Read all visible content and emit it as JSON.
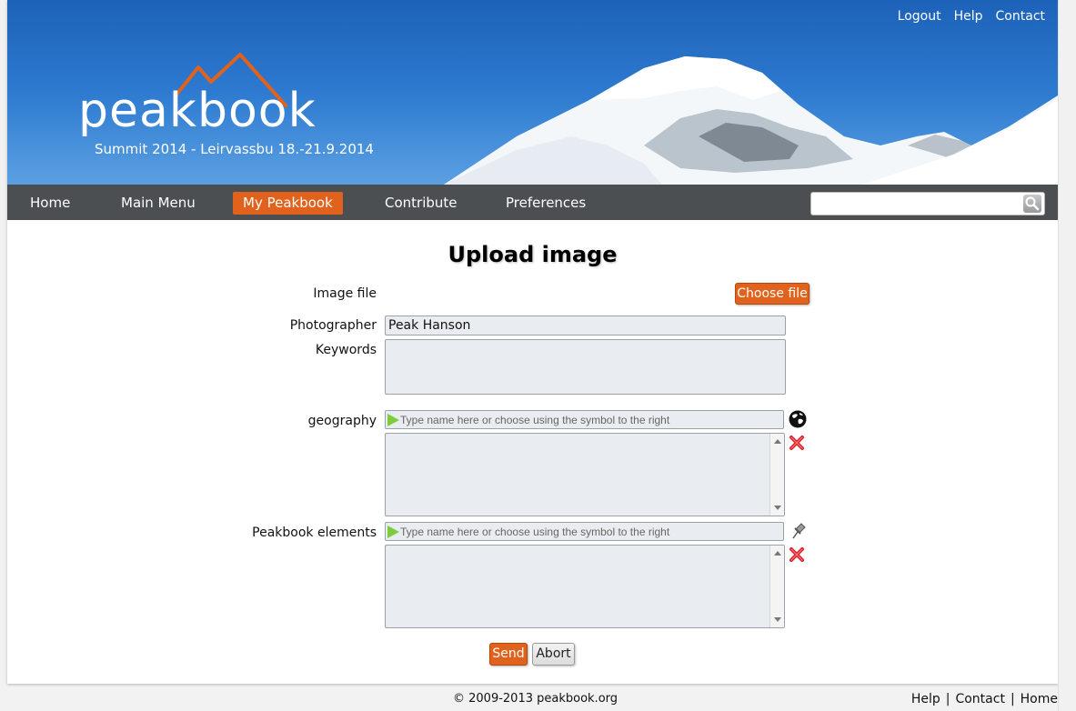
{
  "header": {
    "logo_text": "peakbook",
    "subtitle": "Summit 2014 - Leirvassbu 18.-21.9.2014",
    "top_links": [
      "Logout",
      "Help",
      "Contact"
    ]
  },
  "nav": {
    "items": [
      "Home",
      "Main Menu",
      "My Peakbook",
      "Contribute",
      "Preferences"
    ],
    "active": "My Peakbook",
    "search_value": ""
  },
  "form": {
    "title": "Upload image",
    "image_file_label": "Image file",
    "choose_file_button": "Choose file",
    "photographer_label": "Photographer",
    "photographer_value": "Peak Hanson",
    "keywords_label": "Keywords",
    "keywords_value": "",
    "geography_label": "geography",
    "geography_placeholder": "Type name here or choose using the symbol to the right",
    "elements_label": "Peakbook elements",
    "elements_placeholder": "Type name here or choose using the symbol to the right",
    "send_button": "Send",
    "abort_button": "Abort"
  },
  "icons": {
    "geography_picker": "globe-icon",
    "elements_picker": "pushpin-icon",
    "remove": "red-x-icon",
    "search": "magnifier-icon",
    "combo_marker": "green-play-icon"
  },
  "colors": {
    "accent": "#e0621c",
    "navbar": "#4b4f52",
    "field_bg": "#e9edf1",
    "sky": "#2d7ad0"
  },
  "footer": {
    "copyright": "© 2009-2013 peakbook.org",
    "links": [
      "Help",
      "Contact",
      "Home"
    ]
  }
}
